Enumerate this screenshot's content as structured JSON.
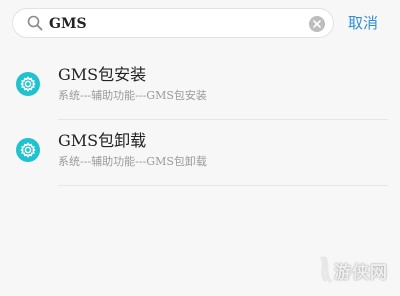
{
  "search": {
    "query": "GMS",
    "cancel_label": "取消"
  },
  "results": [
    {
      "title": "GMS包安装",
      "path": "系统---辅助功能---GMS包安装",
      "icon": "gear-icon"
    },
    {
      "title": "GMS包卸载",
      "path": "系统---辅助功能---GMS包卸载",
      "icon": "gear-icon"
    }
  ],
  "watermark": {
    "text": "游侠网"
  },
  "colors": {
    "accent": "#2f8fd8",
    "icon_teal": "#1fc2cf",
    "background": "#f7f7f7"
  }
}
